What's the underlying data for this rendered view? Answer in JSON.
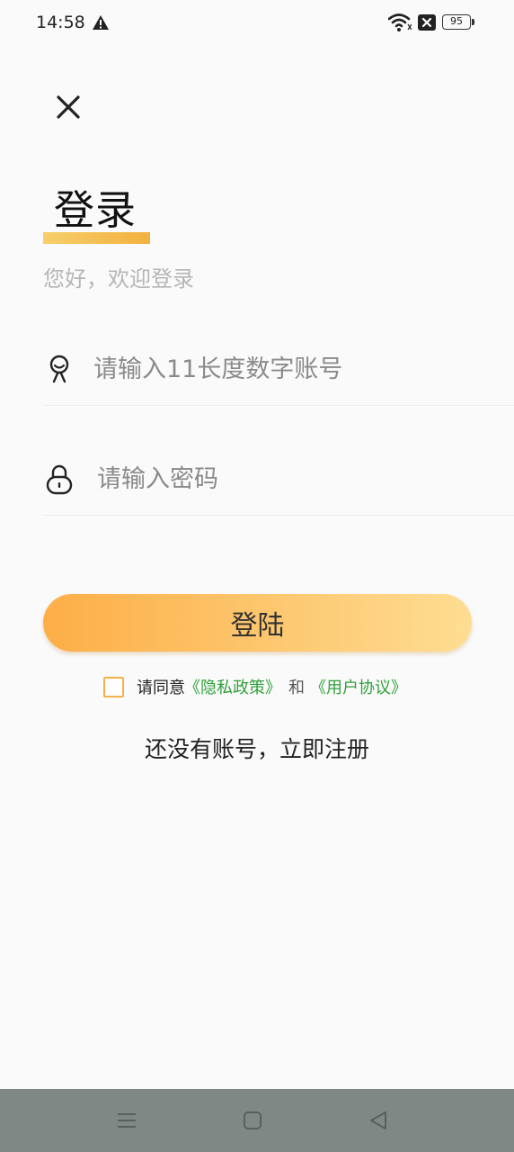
{
  "status_bar": {
    "time": "14:58",
    "battery_level": "95",
    "icons": [
      "warning-icon",
      "wifi-icon",
      "sim-icon",
      "battery-icon"
    ]
  },
  "header": {
    "close_icon": "close-icon",
    "title": "登录",
    "subtitle": "您好，欢迎登录"
  },
  "form": {
    "account": {
      "icon": "user-icon",
      "value": "",
      "placeholder": "请输入11长度数字账号"
    },
    "password": {
      "icon": "lock-icon",
      "value": "",
      "placeholder": "请输入密码"
    },
    "login_button": "登陆",
    "agreement": {
      "checked": false,
      "prefix": "请同意",
      "privacy_link": "《隐私政策》",
      "and": "和",
      "user_link": "《用户协议》"
    },
    "register_link": "还没有账号，立即注册"
  },
  "nav_bar": {
    "buttons": [
      "menu-icon",
      "home-icon",
      "back-icon"
    ]
  },
  "colors": {
    "accent": "#f5b04c",
    "gradient_start": "#fdae47",
    "gradient_end": "#fedd93",
    "link": "#2f9f3a",
    "background": "#fafafa",
    "nav_bar": "#808885"
  }
}
